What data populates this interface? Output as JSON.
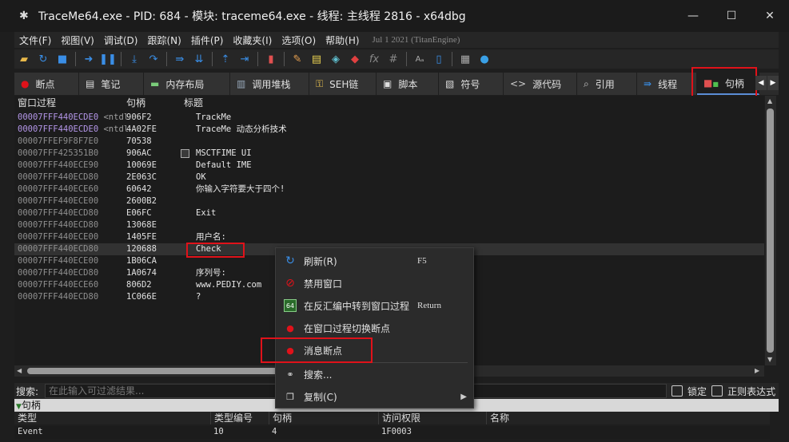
{
  "window": {
    "title": "TraceMe64.exe - PID: 684 - 模块: traceme64.exe - 线程: 主线程 2816 - x64dbg"
  },
  "menubar": {
    "items": [
      "文件(F)",
      "视图(V)",
      "调试(D)",
      "跟踪(N)",
      "插件(P)",
      "收藏夹(I)",
      "选项(O)",
      "帮助(H)"
    ],
    "date": "Jul 1 2021 (TitanEngine)"
  },
  "tabs": [
    {
      "label": "断点",
      "icon": "breakpoint-dot-icon",
      "color": "#e0121a"
    },
    {
      "label": "笔记",
      "icon": "notes-icon"
    },
    {
      "label": "内存布局",
      "icon": "memory-icon"
    },
    {
      "label": "调用堆栈",
      "icon": "callstack-icon"
    },
    {
      "label": "SEH链",
      "icon": "seh-icon"
    },
    {
      "label": "脚本",
      "icon": "script-icon"
    },
    {
      "label": "符号",
      "icon": "symbol-icon"
    },
    {
      "label": "源代码",
      "icon": "source-icon"
    },
    {
      "label": "引用",
      "icon": "reference-icon"
    },
    {
      "label": "线程",
      "icon": "thread-icon"
    },
    {
      "label": "句柄",
      "icon": "handle-icon",
      "active": true
    }
  ],
  "grid": {
    "headers": [
      "窗口过程",
      "句柄",
      "标题"
    ],
    "rows": [
      {
        "proc": "00007FFF440ECDE0",
        "sym": "<ntdl",
        "handle": "906F2",
        "title": "TrackMe",
        "purple": true
      },
      {
        "proc": "00007FFF440ECDE0",
        "sym": "<ntdl",
        "handle": "4A02FE",
        "title": "TraceMe 动态分析技术",
        "purple": true
      },
      {
        "proc": "00007FFEF9F8F7E0",
        "sym": "",
        "handle": "70538",
        "title": ""
      },
      {
        "proc": "00007FFF425351B0",
        "sym": "",
        "handle": "906AC",
        "title": "MSCTFIME UI",
        "checkbox": true
      },
      {
        "proc": "00007FFF440ECE90",
        "sym": "",
        "handle": "10069E",
        "title": "Default IME"
      },
      {
        "proc": "00007FFF440ECD80",
        "sym": "",
        "handle": "2E063C",
        "title": "OK"
      },
      {
        "proc": "00007FFF440ECE60",
        "sym": "",
        "handle": "60642",
        "title": "你输入字符要大于四个!"
      },
      {
        "proc": "00007FFF440ECE00",
        "sym": "",
        "handle": "2600B2",
        "title": ""
      },
      {
        "proc": "00007FFF440ECD80",
        "sym": "",
        "handle": "E06FC",
        "title": "Exit"
      },
      {
        "proc": "00007FFF440ECD80",
        "sym": "",
        "handle": "13068E",
        "title": ""
      },
      {
        "proc": "00007FFF440ECE00",
        "sym": "",
        "handle": "1405FE",
        "title": "用户名:"
      },
      {
        "proc": "00007FFF440ECD80",
        "sym": "",
        "handle": "120688",
        "title": "Check",
        "selected": true
      },
      {
        "proc": "00007FFF440ECE00",
        "sym": "",
        "handle": "1B06CA",
        "title": ""
      },
      {
        "proc": "00007FFF440ECD80",
        "sym": "",
        "handle": "1A0674",
        "title": "序列号:"
      },
      {
        "proc": "00007FFF440ECE60",
        "sym": "",
        "handle": "806D2",
        "title": "www.PEDIY.com"
      },
      {
        "proc": "00007FFF440ECD80",
        "sym": "",
        "handle": "1C066E",
        "title": "?"
      }
    ]
  },
  "search": {
    "label": "搜索:",
    "placeholder": "在此输入可过滤结果...",
    "lock_label": "锁定",
    "regex_label": "正则表达式"
  },
  "section": {
    "label": "句柄"
  },
  "bottom_table": {
    "headers": [
      "类型",
      "类型编号",
      "句柄",
      "访问权限",
      "名称"
    ],
    "row": [
      "Event",
      "10",
      "4",
      "1F0003",
      ""
    ]
  },
  "context_menu": {
    "items": [
      {
        "label": "刷新(R)",
        "shortcut": "F5",
        "icon": "refresh-icon"
      },
      {
        "label": "禁用窗口",
        "shortcut": "",
        "icon": "disable-icon"
      },
      {
        "label": "在反汇编中转到窗口过程",
        "shortcut": "Return",
        "icon": "disasm-goto-icon"
      },
      {
        "label": "在窗口过程切换断点",
        "shortcut": "",
        "icon": "toggle-breakpoint-icon"
      },
      {
        "label": "消息断点",
        "shortcut": "",
        "icon": "message-breakpoint-icon"
      },
      {
        "label": "搜索...",
        "shortcut": "",
        "icon": "binoculars-icon"
      },
      {
        "label": "复制(C)",
        "shortcut": "",
        "icon": "copy-icon",
        "submenu": true
      }
    ]
  },
  "colors": {
    "accent_red": "#e0121a",
    "purple_text": "#b496e8",
    "tab_underline": "#5b8dd6"
  }
}
